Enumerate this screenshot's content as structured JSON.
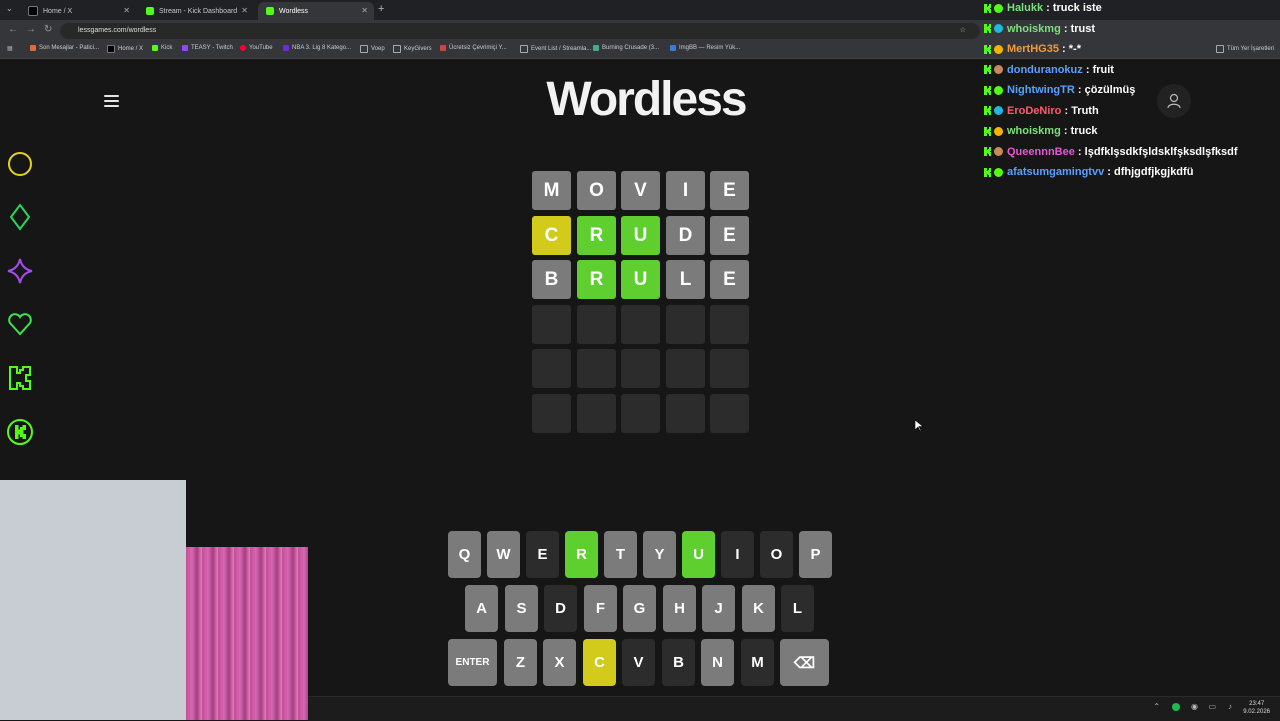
{
  "browser": {
    "tabs": [
      {
        "label": "Home / X",
        "icon": "x-logo-icon"
      },
      {
        "label": "Stream - Kick Dashboard",
        "icon": "kick-logo-icon"
      },
      {
        "label": "Wordless",
        "icon": "wordless-favicon-icon"
      }
    ],
    "new_tab_label": "+",
    "url": "lessgames.com/wordless",
    "bookmarks": [
      "Son Mesajlar - Patici...",
      "Home / X",
      "Kick",
      "TEASY - Twitch",
      "YouTube",
      "NBA 3. Lig 8 Katego...",
      "Voep",
      "KeyGivers",
      "Ücretsiz Çevrimiçi Y...",
      "Event List / Streamla...",
      "Burning Crusade (3...",
      "ImgBB — Resim Yük..."
    ],
    "all_bookmarks_label": "Tüm Yer İşaretleri"
  },
  "page": {
    "logo": "Wordless",
    "grid": [
      [
        {
          "l": "M",
          "s": "absent"
        },
        {
          "l": "O",
          "s": "absent"
        },
        {
          "l": "V",
          "s": "absent"
        },
        {
          "l": "I",
          "s": "absent"
        },
        {
          "l": "E",
          "s": "absent"
        }
      ],
      [
        {
          "l": "C",
          "s": "present"
        },
        {
          "l": "R",
          "s": "correct"
        },
        {
          "l": "U",
          "s": "correct"
        },
        {
          "l": "D",
          "s": "absent"
        },
        {
          "l": "E",
          "s": "absent"
        }
      ],
      [
        {
          "l": "B",
          "s": "absent"
        },
        {
          "l": "R",
          "s": "correct"
        },
        {
          "l": "U",
          "s": "correct"
        },
        {
          "l": "L",
          "s": "absent"
        },
        {
          "l": "E",
          "s": "absent"
        }
      ],
      [
        {
          "l": "",
          "s": "empty"
        },
        {
          "l": "",
          "s": "empty"
        },
        {
          "l": "",
          "s": "empty"
        },
        {
          "l": "",
          "s": "empty"
        },
        {
          "l": "",
          "s": "empty"
        }
      ],
      [
        {
          "l": "",
          "s": "empty"
        },
        {
          "l": "",
          "s": "empty"
        },
        {
          "l": "",
          "s": "empty"
        },
        {
          "l": "",
          "s": "empty"
        },
        {
          "l": "",
          "s": "empty"
        }
      ],
      [
        {
          "l": "",
          "s": "empty"
        },
        {
          "l": "",
          "s": "empty"
        },
        {
          "l": "",
          "s": "empty"
        },
        {
          "l": "",
          "s": "empty"
        },
        {
          "l": "",
          "s": "empty"
        }
      ]
    ],
    "keyboard": [
      [
        {
          "k": "Q",
          "s": "unused"
        },
        {
          "k": "W",
          "s": "unused"
        },
        {
          "k": "E",
          "s": "absent"
        },
        {
          "k": "R",
          "s": "correct"
        },
        {
          "k": "T",
          "s": "unused"
        },
        {
          "k": "Y",
          "s": "unused"
        },
        {
          "k": "U",
          "s": "correct"
        },
        {
          "k": "I",
          "s": "absent"
        },
        {
          "k": "O",
          "s": "absent"
        },
        {
          "k": "P",
          "s": "unused"
        }
      ],
      [
        {
          "k": "A",
          "s": "unused"
        },
        {
          "k": "S",
          "s": "unused"
        },
        {
          "k": "D",
          "s": "absent"
        },
        {
          "k": "F",
          "s": "unused"
        },
        {
          "k": "G",
          "s": "unused"
        },
        {
          "k": "H",
          "s": "unused"
        },
        {
          "k": "J",
          "s": "unused"
        },
        {
          "k": "K",
          "s": "unused"
        },
        {
          "k": "L",
          "s": "absent"
        }
      ],
      [
        {
          "k": "ENTER",
          "s": "unused"
        },
        {
          "k": "Z",
          "s": "unused"
        },
        {
          "k": "X",
          "s": "unused"
        },
        {
          "k": "C",
          "s": "present"
        },
        {
          "k": "V",
          "s": "absent"
        },
        {
          "k": "B",
          "s": "absent"
        },
        {
          "k": "N",
          "s": "unused"
        },
        {
          "k": "M",
          "s": "absent"
        },
        {
          "k": "⌫",
          "s": "unused"
        }
      ]
    ],
    "side_icons": [
      "circle-icon",
      "diamond-icon",
      "sparkle-icon",
      "heart-icon",
      "kick-k-icon",
      "kick-coin-icon"
    ]
  },
  "chat": [
    {
      "user": "Halukk",
      "color": "#7be07b",
      "text": "truck iste"
    },
    {
      "user": "whoiskmg",
      "color": "#7be07b",
      "text": "trust"
    },
    {
      "user": "MertHG35",
      "color": "#f39a3c",
      "text": "*-*"
    },
    {
      "user": "donduranokuz",
      "color": "#5aa0ff",
      "text": "fruit"
    },
    {
      "user": "NightwingTR",
      "color": "#5aa0ff",
      "text": "çözülmüş"
    },
    {
      "user": "EroDeNiro",
      "color": "#ff5a6e",
      "text": "Truth"
    },
    {
      "user": "whoiskmg",
      "color": "#7be07b",
      "text": "truck"
    },
    {
      "user": "QueennnBee",
      "color": "#e25ad0",
      "text": "lşdfklşsdkfşldsklfşksdlşfksdf"
    },
    {
      "user": "afatsumgamingtvv",
      "color": "#5aa0ff",
      "text": "dfhjgdfjkgjkdfü"
    }
  ],
  "taskbar": {
    "time": "23:47",
    "date": "9.02.2026"
  },
  "colors": {
    "correct": "#5fcf30",
    "present": "#d3cb1c",
    "absent": "#7b7b7b",
    "empty": "#2c2c2c",
    "background": "#161616"
  }
}
